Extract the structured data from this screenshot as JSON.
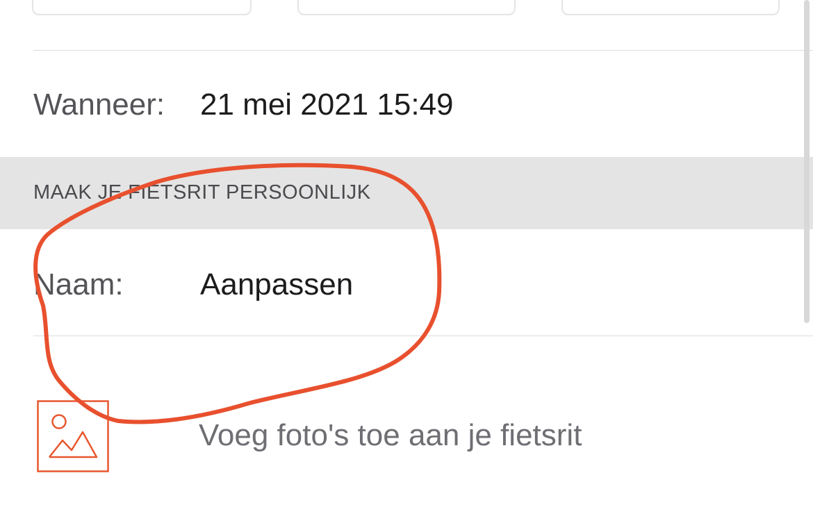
{
  "when": {
    "label": "Wanneer:",
    "value": "21 mei 2021 15:49"
  },
  "personalize": {
    "section_title": "MAAK JE FIETSRIT PERSOONLIJK"
  },
  "name": {
    "label": "Naam:",
    "value": "Aanpassen"
  },
  "photos": {
    "label": "Voeg foto's toe aan je fietsrit",
    "icon": "image-icon"
  },
  "colors": {
    "accent": "#e8572f",
    "annotation": "#e8502e",
    "section_background": "#e4e4e4"
  }
}
